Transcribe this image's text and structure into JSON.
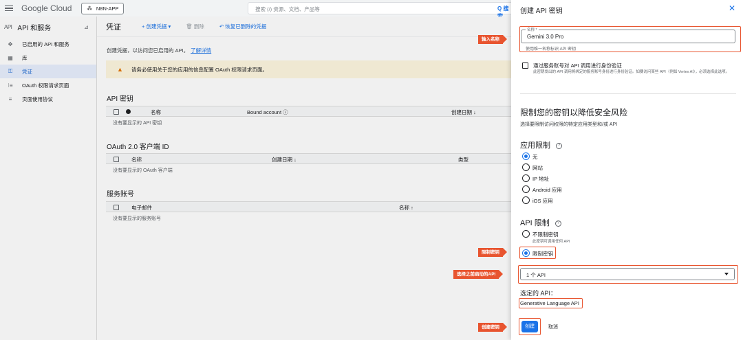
{
  "topbar": {
    "brand": "Google Cloud",
    "project": "N8N-APP",
    "search_placeholder": "搜索 (/) 资源、文档、产品等",
    "search_button": "Q 搜索"
  },
  "sidebar": {
    "icon_text": "API",
    "title": "API 和服务",
    "items": [
      {
        "label": "已启用的 API 和服务",
        "icon": "✥"
      },
      {
        "label": "库",
        "icon": "▦"
      },
      {
        "label": "凭证",
        "icon": "⚿"
      },
      {
        "label": "OAuth 权限请求页面",
        "icon": "⁝≡"
      },
      {
        "label": "页面使用协议",
        "icon": "≡"
      }
    ]
  },
  "main": {
    "title": "凭证",
    "create_credentials": "+ 创建凭据 ▾",
    "delete": "🗑 删除",
    "restore": "↶ 恢复已删除的凭据",
    "description": "创建凭据，以访问您已启用的 API。",
    "learn_more": "了解详情",
    "warning": "请务必使用关于您的应用的信息配置 OAuth 权限请求页面。",
    "api_keys": {
      "heading": "API 密钥",
      "col_name": "名称",
      "col_account": "Bound account ⓘ",
      "col_date": "创建日期 ↓",
      "empty": "没有要显示的 API 密钥"
    },
    "oauth": {
      "heading": "OAuth 2.0 客户端 ID",
      "col_name": "名称",
      "col_date": "创建日期 ↓",
      "col_type": "类型",
      "empty": "没有要显示的 OAuth 客户端"
    },
    "service_accounts": {
      "heading": "服务账号",
      "col_email": "电子邮件",
      "col_name": "名称 ↑",
      "empty": "没有要显示的服务账号"
    }
  },
  "panel": {
    "title": "创建 API 密钥",
    "name_label": "名称 *",
    "name_value": "Gemini 3.0 Pro",
    "name_hint": "使用唯一名称标识 API 密钥",
    "sa_checkbox": "通过服务账号对 API 调用进行身份验证",
    "sa_desc": "此密钥发出的 API 调用将绑定的服务账号身份进行身份验证。如要访问某些 API（例如 Vertex AI），必须选择此选项。",
    "restrict_heading": "限制您的密钥以降低安全风险",
    "restrict_sub": "选择要限制访问权限的特定应用类型和/或 API",
    "app_restrict_heading": "应用限制",
    "app_options": [
      "无",
      "网站",
      "IP 地址",
      "Android 应用",
      "iOS 应用"
    ],
    "app_selected": 0,
    "api_restrict_heading": "API 限制",
    "api_opt_none": "不限制密钥",
    "api_opt_none_sub": "此密钥可调用任何 API",
    "api_opt_restrict": "限制密钥",
    "api_select_value": "1 个 API",
    "selected_heading": "选定的 API：",
    "selected_api": "Generative Language API",
    "create_button": "创建",
    "cancel_button": "取消"
  },
  "annotations": {
    "enter_name": "输入名称",
    "restrict_key": "限制密钥",
    "choose_api": "选择之前启动的API",
    "create_key": "创建密钥"
  },
  "colors": {
    "accent": "#1a73e8",
    "annotation": "#e8542f",
    "warning_bg": "#fef7e0"
  }
}
